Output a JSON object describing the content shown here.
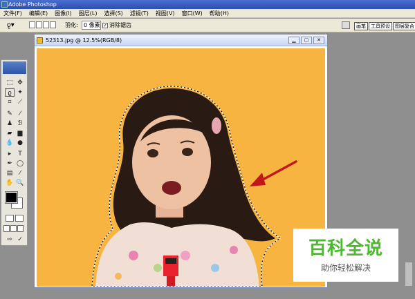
{
  "app": {
    "title": "Adobe Photoshop"
  },
  "menu": [
    "文件(F)",
    "编辑(E)",
    "图像(I)",
    "图层(L)",
    "选择(S)",
    "滤镜(T)",
    "视图(V)",
    "窗口(W)",
    "帮助(H)"
  ],
  "options": {
    "feather_label": "羽化:",
    "feather_value": "0 像素",
    "antialias_label": "消除锯齿",
    "antialias_checked": true,
    "palettes": [
      "画笔",
      "工具预设",
      "图层复合"
    ]
  },
  "document": {
    "title": "52313.jpg @ 12.5%(RGB/8)",
    "background_color": "#f8b441"
  },
  "colors": {
    "foreground": "#000000",
    "background": "#ffffff",
    "arrow": "#c0181c"
  },
  "watermark": {
    "main": "百科全说",
    "sub": "助你轻松解决"
  }
}
